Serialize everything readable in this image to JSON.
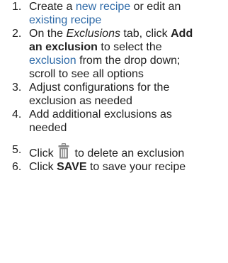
{
  "steps": [
    {
      "number": "1.",
      "text_before": "Create a ",
      "link1": "new recipe",
      "text_mid": " or edit an ",
      "link2": "existing recipe"
    },
    {
      "number": "2.",
      "text_before": "On the ",
      "italic": "Exclusions",
      "text_mid": " tab, click ",
      "bold": "Add an exclusion",
      "text_mid2": " to select the ",
      "link": "exclusion",
      "text_after": " from the drop down; scroll to see all options"
    },
    {
      "number": "3.",
      "text": "Adjust configurations for the exclusion as needed"
    },
    {
      "number": "4.",
      "text": "Add additional exclusions as needed"
    },
    {
      "number": "5.",
      "text_before": "Click ",
      "icon": "trash-icon",
      "text_after": " to delete an exclusion"
    },
    {
      "number": "6.",
      "text_before": "Click ",
      "bold": "SAVE",
      "text_after": " to save your recipe"
    }
  ],
  "colors": {
    "link": "#2e6aa8",
    "text": "#222222",
    "icon": "#8a8a8a"
  }
}
